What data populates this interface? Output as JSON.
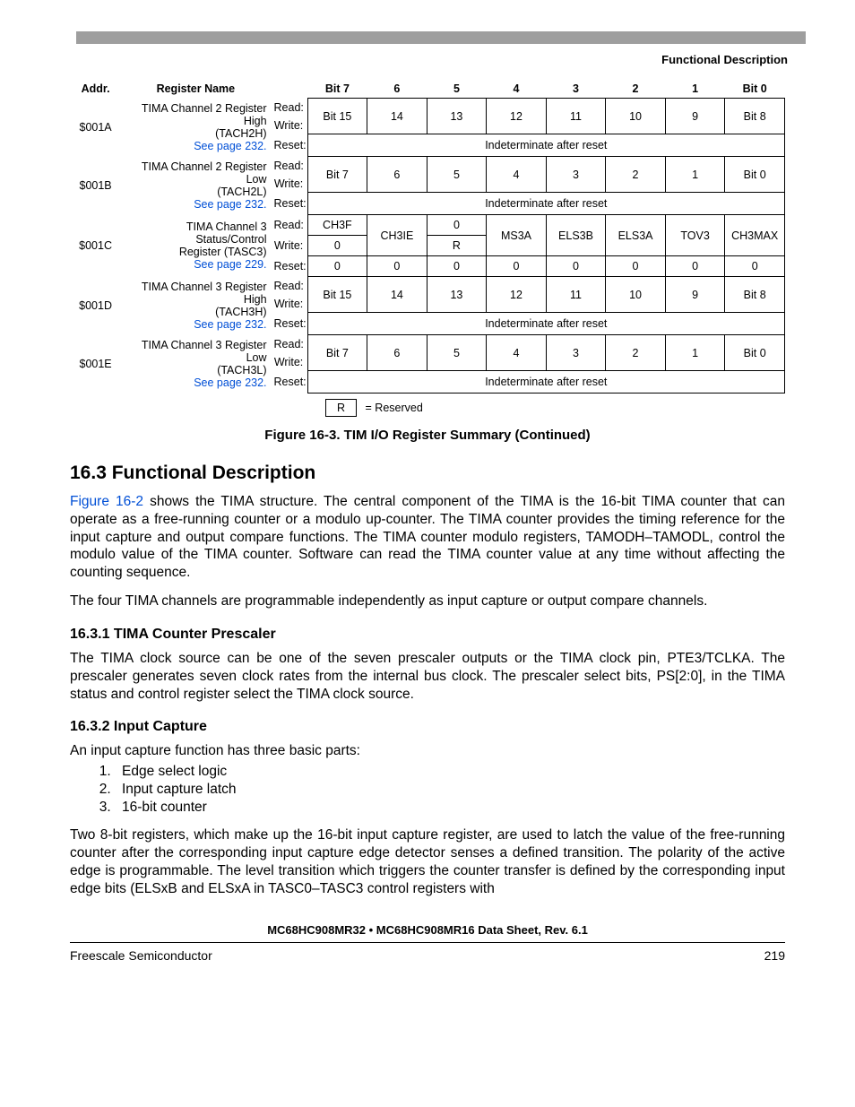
{
  "header": {
    "right": "Functional Description"
  },
  "table_header": {
    "addr": "Addr.",
    "name": "Register Name",
    "bit7": "Bit 7",
    "b6": "6",
    "b5": "5",
    "b4": "4",
    "b3": "3",
    "b2": "2",
    "b1": "1",
    "bit0": "Bit 0"
  },
  "ops": {
    "read": "Read:",
    "write": "Write:",
    "reset": "Reset:"
  },
  "regs": [
    {
      "addr": "$001A",
      "name1": "TIMA Channel 2 Register High",
      "name2": "(TACH2H)",
      "link": "See page 232.",
      "bits": [
        "Bit 15",
        "14",
        "13",
        "12",
        "11",
        "10",
        "9",
        "Bit 8"
      ],
      "reset": "Indeterminate after reset"
    },
    {
      "addr": "$001B",
      "name1": "TIMA Channel 2 Register Low",
      "name2": "(TACH2L)",
      "link": "See page 232.",
      "bits": [
        "Bit 7",
        "6",
        "5",
        "4",
        "3",
        "2",
        "1",
        "Bit 0"
      ],
      "reset": "Indeterminate after reset"
    },
    {
      "addr": "$001C",
      "name1": "TIMA Channel 3 Status/Control",
      "name2": "Register (TASC3)",
      "link": "See page 229.",
      "read": [
        "CH3F",
        "CH3IE",
        "0",
        "MS3A",
        "ELS3B",
        "ELS3A",
        "TOV3",
        "CH3MAX"
      ],
      "write": [
        "0",
        "",
        "R",
        "",
        "",
        "",
        "",
        ""
      ],
      "reset_row": [
        "0",
        "0",
        "0",
        "0",
        "0",
        "0",
        "0",
        "0"
      ]
    },
    {
      "addr": "$001D",
      "name1": "TIMA Channel 3 Register High",
      "name2": "(TACH3H)",
      "link": "See page 232.",
      "bits": [
        "Bit 15",
        "14",
        "13",
        "12",
        "11",
        "10",
        "9",
        "Bit 8"
      ],
      "reset": "Indeterminate after reset"
    },
    {
      "addr": "$001E",
      "name1": "TIMA Channel 3 Register Low",
      "name2": "(TACH3L)",
      "link": "See page 232.",
      "bits": [
        "Bit 7",
        "6",
        "5",
        "4",
        "3",
        "2",
        "1",
        "Bit 0"
      ],
      "reset": "Indeterminate after reset"
    }
  ],
  "legend": {
    "r": "R",
    "eq": "= Reserved"
  },
  "figure_caption": "Figure 16-3. TIM I/O Register Summary (Continued)",
  "section": {
    "title": "16.3  Functional Description",
    "p1a": "Figure 16-2",
    "p1b": " shows the TIMA structure. The central component of the TIMA is the 16-bit TIMA counter that can operate as a free-running counter or a modulo up-counter. The TIMA counter provides the timing reference for the input capture and output compare functions. The TIMA counter modulo registers, TAMODH–TAMODL, control the modulo value of the TIMA counter. Software can read the TIMA counter value at any time without affecting the counting sequence.",
    "p2": "The four TIMA channels are programmable independently as input capture or output compare channels.",
    "sub1_title": "16.3.1  TIMA Counter Prescaler",
    "sub1_p": "The TIMA clock source can be one of the seven prescaler outputs or the TIMA clock pin, PTE3/TCLKA. The prescaler generates seven clock rates from the internal bus clock. The prescaler select bits, PS[2:0], in the TIMA status and control register select the TIMA clock source.",
    "sub2_title": "16.3.2  Input Capture",
    "sub2_intro": "An input capture function has three basic parts:",
    "sub2_list": [
      "Edge select logic",
      "Input capture latch",
      "16-bit counter"
    ],
    "sub2_p": "Two 8-bit registers, which make up the 16-bit input capture register, are used to latch the value of the free-running counter after the corresponding input capture edge detector senses a defined transition. The polarity of the active edge is programmable. The level transition which triggers the counter transfer is defined by the corresponding input edge bits (ELSxB and ELSxA in TASC0–TASC3 control registers with"
  },
  "footer": {
    "doc": "MC68HC908MR32 • MC68HC908MR16 Data Sheet, Rev. 6.1",
    "left": "Freescale Semiconductor",
    "right": "219"
  }
}
